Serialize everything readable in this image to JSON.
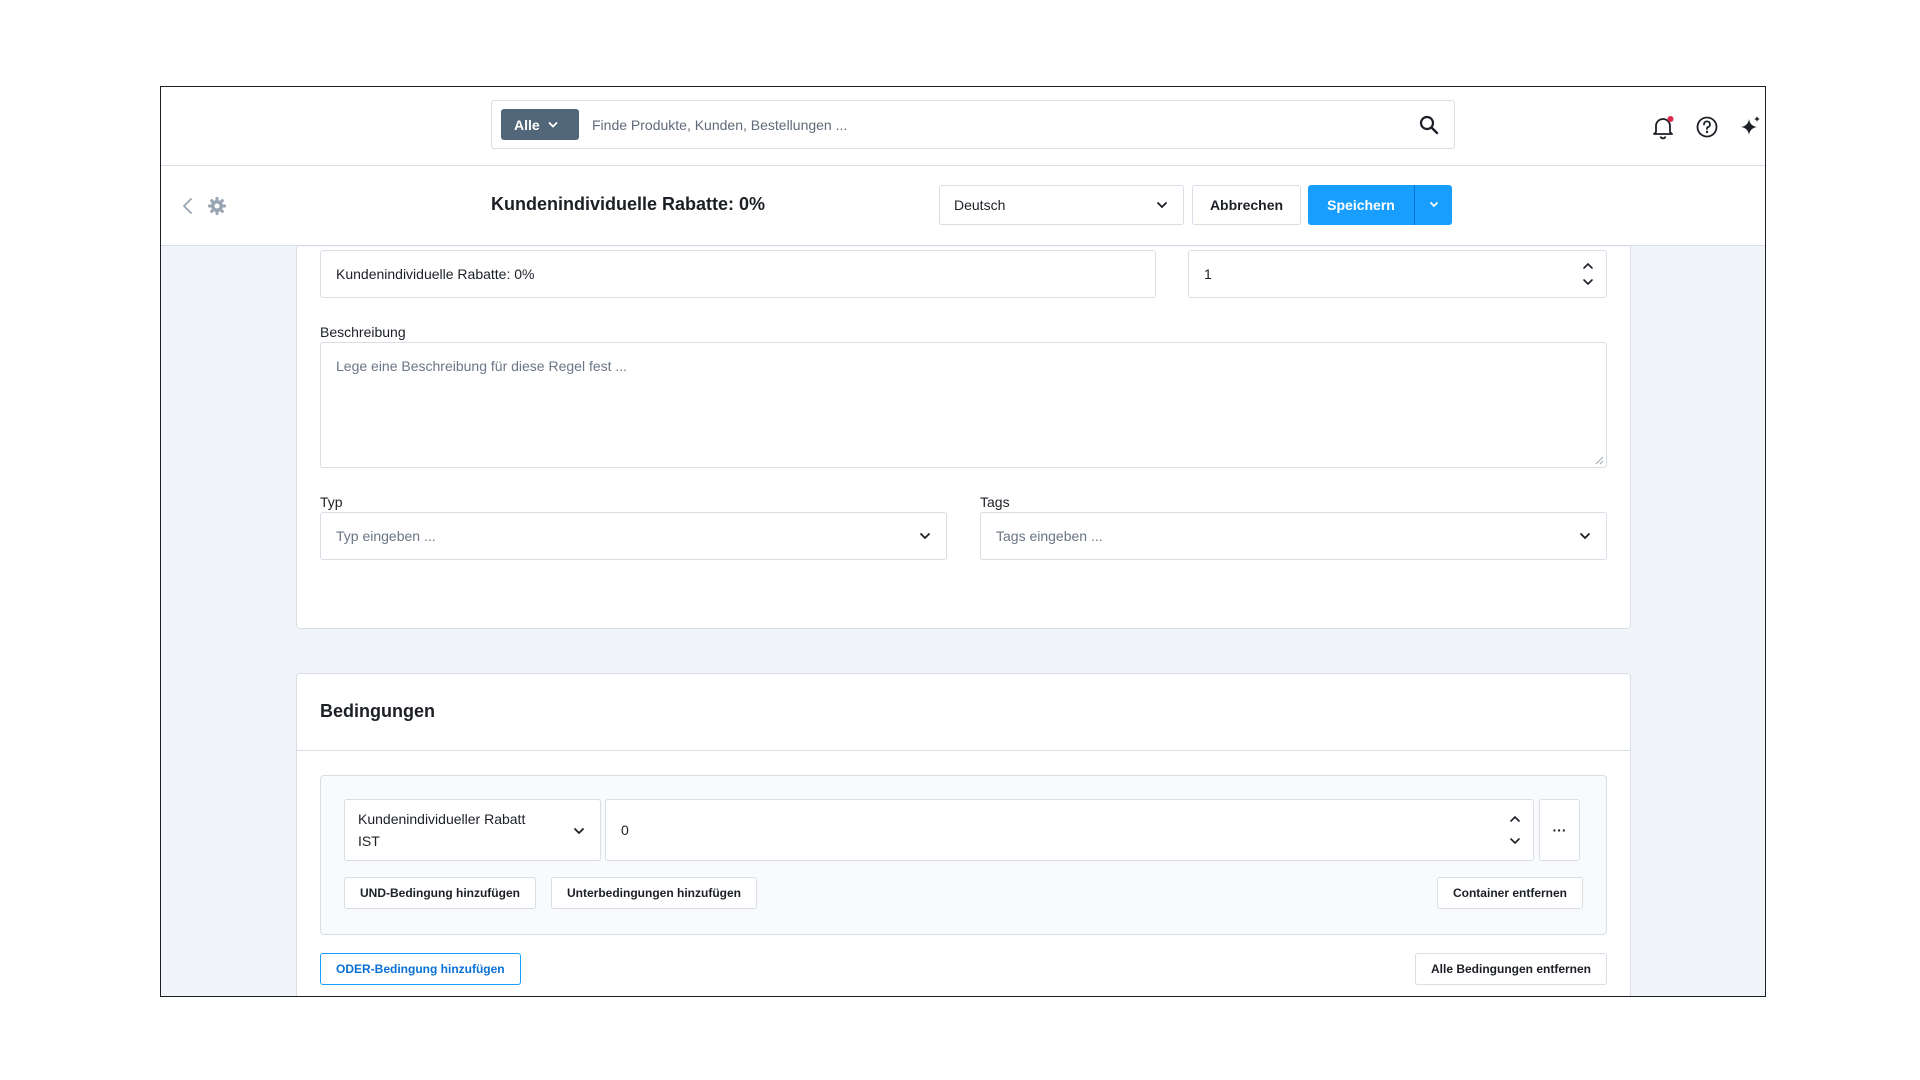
{
  "topbar": {
    "search_scope": "Alle",
    "search_placeholder": "Finde Produkte, Kunden, Bestellungen ...",
    "icons": [
      "bell-icon",
      "help-icon",
      "sparkle-icon"
    ],
    "notification_dot_color": "#de294c"
  },
  "smartbar": {
    "title": "Kundenindividuelle Rabatte: 0%",
    "language": "Deutsch",
    "cancel_label": "Abbrechen",
    "save_label": "Speichern",
    "accent_color": "#189eff"
  },
  "general": {
    "name_value": "Kundenindividuelle Rabatte: 0%",
    "priority_value": "1",
    "description_label": "Beschreibung",
    "description_placeholder": "Lege eine Beschreibung für diese Regel fest ...",
    "type_label": "Typ",
    "type_placeholder": "Typ eingeben ...",
    "tags_label": "Tags",
    "tags_placeholder": "Tags eingeben ..."
  },
  "conditions": {
    "title": "Bedingungen",
    "condition_type_line1": "Kundenindividueller Rabatt",
    "condition_type_line2": "IST",
    "condition_value": "0",
    "more_label": "···",
    "add_and_label": "UND-Bedingung hinzufügen",
    "add_sub_label": "Unterbedingungen hinzufügen",
    "remove_container_label": "Container entfernen",
    "add_or_label": "ODER-Bedingung hinzufügen",
    "remove_all_label": "Alle Bedingungen entfernen"
  }
}
